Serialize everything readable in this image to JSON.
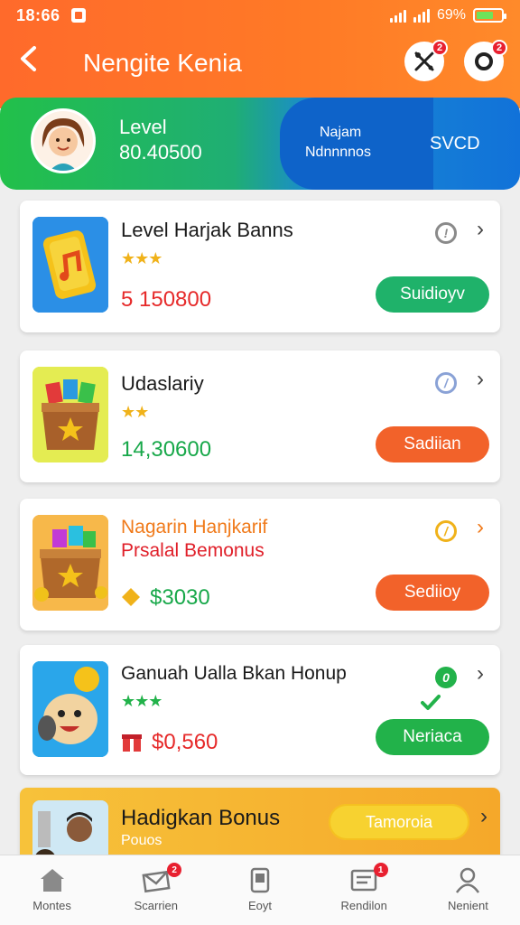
{
  "status": {
    "time": "18:66",
    "battery_text": "69%"
  },
  "header": {
    "title": "Nengite Kenia",
    "icon1_badge": "2",
    "icon2_badge": "2"
  },
  "level_banner": {
    "label": "Level",
    "value": "80.40500",
    "mid_line1": "Najam",
    "mid_line2": "Ndnnnnos",
    "right_label": "SVCD"
  },
  "cards": [
    {
      "title": "Level Harjak Banns",
      "stars": "★★★",
      "amount": "5 150800",
      "button": "Suidioyv",
      "colors": {
        "amount": "#e62a2a",
        "button": "#1fb26a",
        "info": "#8a8a8a"
      }
    },
    {
      "title": "Udaslariy",
      "stars": "★★",
      "amount": "14,30600",
      "button": "Sadiian",
      "colors": {
        "amount": "#18a84a",
        "button": "#f2622a",
        "info": "#8aa2d6"
      }
    },
    {
      "title": "Nagarin Hanjkarif",
      "subtitle": "Prsalal Bemonus",
      "stars": "",
      "amount": "$3030",
      "button": "Sediioy",
      "colors": {
        "title": "#f07a1a",
        "subtitle": "#e0202a",
        "amount": "#18a84a",
        "button": "#f2622a",
        "info": "#f0b21a"
      }
    },
    {
      "title": "Ganuah Ualla Bkan Honup",
      "stars": "★★★",
      "amount": "$0,560",
      "button": "Neriaca",
      "colors": {
        "amount": "#e62a2a",
        "button": "#22b24a",
        "info": "#22b24a"
      }
    }
  ],
  "bonus_card": {
    "title": "Hadigkan Bonus",
    "subtitle": "Pouos",
    "button": "Tamoroia"
  },
  "bottom_nav": [
    {
      "label": "Montes",
      "icon": "home-icon"
    },
    {
      "label": "Scarrien",
      "icon": "mail-icon",
      "badge": "2"
    },
    {
      "label": "Eoyt",
      "icon": "clipboard-icon"
    },
    {
      "label": "Rendilon",
      "icon": "list-icon",
      "badge": "1"
    },
    {
      "label": "Nenient",
      "icon": "profile-icon"
    }
  ]
}
